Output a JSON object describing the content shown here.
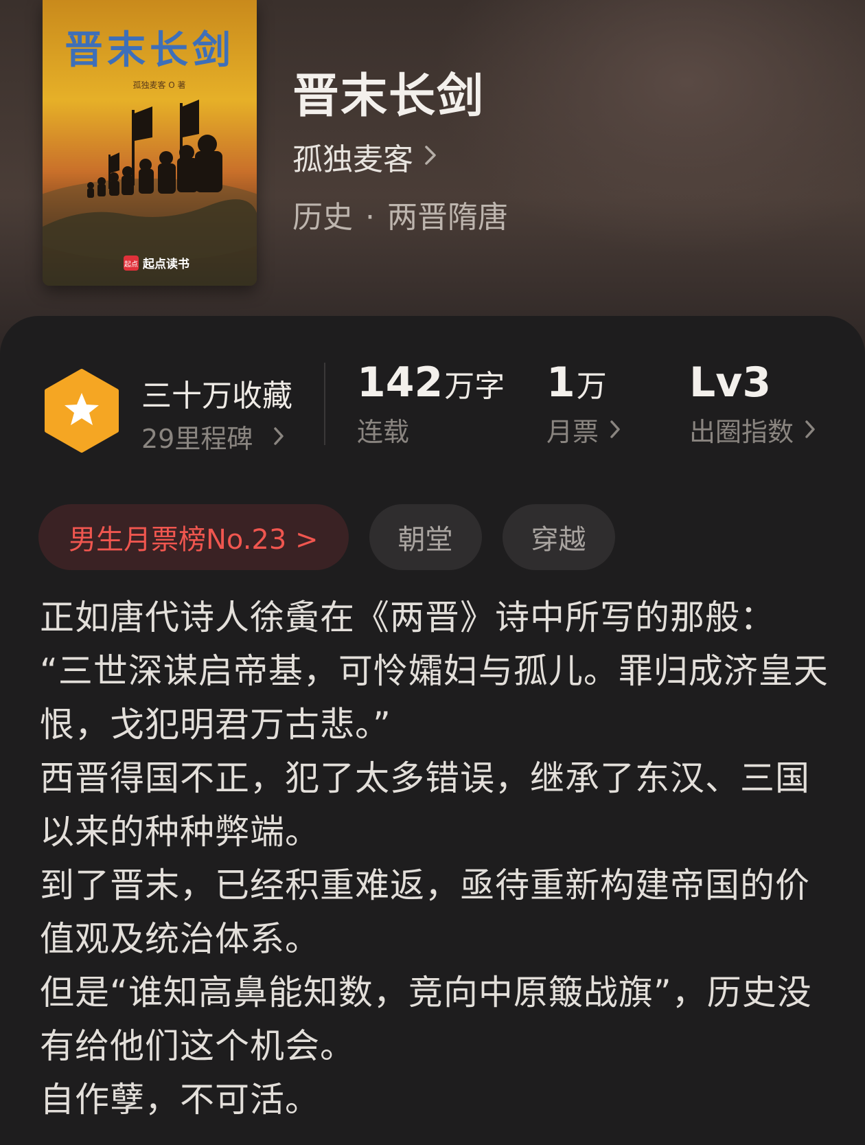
{
  "book": {
    "title": "晋末长剑",
    "author": "孤独麦客",
    "genre_main": "历史",
    "genre_sub": "两晋隋唐",
    "cover": {
      "title": "晋末长剑",
      "author_line": "孤独麦客 O 著",
      "publisher": "起点读书",
      "publisher_badge": "起点"
    }
  },
  "stats": {
    "favorites": {
      "main": "三十万收藏",
      "sub": "29里程碑"
    },
    "words": {
      "number": "142",
      "unit": "万字",
      "label": "连载"
    },
    "tickets": {
      "number": "1",
      "unit": "万",
      "label": "月票"
    },
    "index": {
      "number": "Lv3",
      "label": "出圈指数"
    }
  },
  "tags": {
    "rank": "男生月票榜No.23 >",
    "tag1": "朝堂",
    "tag2": "穿越"
  },
  "description": [
    "正如唐代诗人徐夤在《两晋》诗中所写的那般：",
    "“三世深谋启帝基，可怜孀妇与孤儿。罪归成济皇天恨，戈犯明君万古悲。”",
    "西晋得国不正，犯了太多错误，继承了东汉、三国以来的种种弊端。",
    "到了晋末，已经积重难返，亟待重新构建帝国的价值观及统治体系。",
    "但是“谁知高鼻能知数，竞向中原簸战旗”，历史没有给他们这个机会。",
    "自作孽，不可活。"
  ],
  "colors": {
    "accent_red": "#f0564f",
    "badge_orange": "#f5a623",
    "background": "#1f1e1f"
  },
  "icons": [
    "star-badge-icon",
    "chevron-right-icon"
  ]
}
